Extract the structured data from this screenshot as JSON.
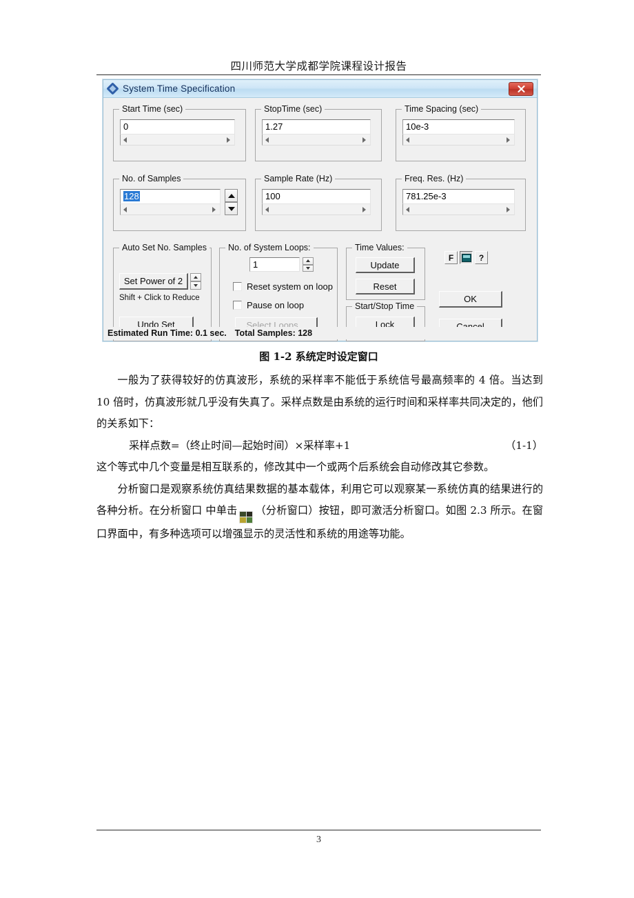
{
  "document": {
    "running_header": "四川师范大学成都学院课程设计报告",
    "page_number": "3",
    "figure_caption": "图 1-2 系统定时设定窗口",
    "paragraphs": {
      "p1": "一般为了获得较好的仿真波形，系统的采样率不能低于系统信号最高频率的 4 倍。当达到 10 倍时，仿真波形就几乎没有失真了。采样点数是由系统的运行时间和采样率共同决定的，他们的关系如下：",
      "equation": "采样点数=（终止时间—起始时间）×采样率+1",
      "equation_number": "（1-1）",
      "p2": "这个等式中几个变量是相互联系的，修改其中一个或两个后系统会自动修改其它参数。",
      "p3_before_icon": "分析窗口是观察系统仿真结果数据的基本载体，利用它可以观察某一系统仿真的结果进行的各种分析。在分析窗口 中单击",
      "p3_after_icon": "（分析窗口）按钮，即可激活分析窗口。如图 2.3 所示。在窗口界面中，有多种选项可以增强显示的灵活性和系统的用途等功能。"
    }
  },
  "dialog": {
    "title": "System Time Specification",
    "close_label": "✕",
    "groups": {
      "start_time": {
        "label": "Start Time (sec)",
        "value": "0"
      },
      "stop_time": {
        "label": "StopTime (sec)",
        "value": "1.27"
      },
      "time_spacing": {
        "label": "Time Spacing (sec)",
        "value": "10e-3"
      },
      "no_of_samples": {
        "label": "No. of Samples",
        "value": "128"
      },
      "sample_rate": {
        "label": "Sample Rate (Hz)",
        "value": "100"
      },
      "freq_res": {
        "label": "Freq. Res. (Hz)",
        "value": "781.25e-3"
      },
      "auto_set": {
        "label": "Auto Set No. Samples",
        "set_power_button": "Set Power of 2",
        "hint": "Shift + Click to Reduce",
        "undo_button": "Undo Set"
      },
      "system_loops": {
        "label": "No. of System Loops:",
        "value": "1",
        "reset_checkbox": "Reset system on loop",
        "pause_checkbox": "Pause on loop",
        "select_loops_button": "Select Loops..."
      },
      "time_values": {
        "label": "Time Values:",
        "update_button": "Update",
        "reset_button": "Reset"
      },
      "start_stop_time": {
        "label": "Start/Stop Time",
        "lock_button": "Lock"
      }
    },
    "tiny_toolbar": {
      "formula_button": "F",
      "calculator_button": "calculator",
      "help_button": "?"
    },
    "ok_button": "OK",
    "cancel_button": "Cancel",
    "status": {
      "estimated_run_time": "Estimated Run Time: 0.1 sec.",
      "total_samples": "Total Samples: 128"
    }
  },
  "colors": {
    "titlebar_accent": "#bcdcf2",
    "close_red": "#cf4033",
    "selection_blue": "#2a7ad4",
    "dialog_face": "#f0f0f0"
  }
}
